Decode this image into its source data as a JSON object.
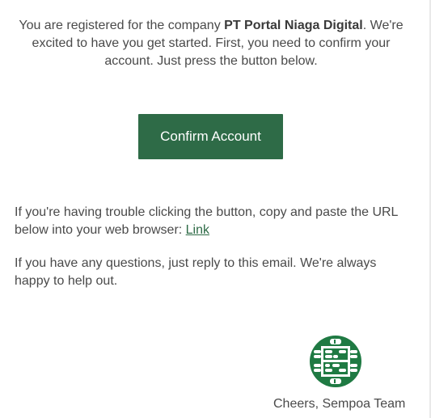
{
  "intro": {
    "part1": "You are registered for the company ",
    "company": "PT Portal Niaga Digital",
    "part2": ". We're excited to have you get started. First, you need to confirm your account. Just press the button below."
  },
  "confirm_button": {
    "label": "Confirm Account",
    "color": "#2e6b47"
  },
  "trouble": {
    "text": "If you're having trouble clicking the button, copy and paste the URL below into your web browser: ",
    "link_label": "Link"
  },
  "questions": {
    "text": "If you have any questions, just reply to this email. We're always happy to help out."
  },
  "signoff": {
    "text": "Cheers, Sempoa Team",
    "logo_icon": "sempoa-abacus-logo",
    "logo_color": "#1f7a43"
  }
}
